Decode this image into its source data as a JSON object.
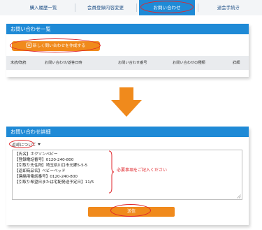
{
  "nav": {
    "tabs": [
      {
        "label": "購入履歴一覧"
      },
      {
        "label": "会員登録内容変更"
      },
      {
        "label": "お問い合わせ"
      },
      {
        "label": "退会手続き"
      }
    ],
    "active_index": 2
  },
  "list_panel": {
    "title": "お問い合わせ一覧",
    "create_button_label": "新しく問い合わせを作成する",
    "columns": [
      "未読/既読",
      "お問い合わせ/返答日時",
      "お問い合わせ番号",
      "お問い合わせの種類",
      "詳細"
    ]
  },
  "detail_panel": {
    "title": "お問い合わせ詳細",
    "category_selected": "返却について",
    "message_lines": [
      "【氏名】ホクソンベビー",
      "【登録電話番号】0120-240-800",
      "【引取り先住所】埼玉県川口市元郷5-5-5",
      "【返却商品名】ベビーベッド",
      "【連絡用電話番号】0120-240-800",
      "【引取り希望日または宅配発送予定日】11/5"
    ],
    "annotation": "必要事項をご記入ください",
    "submit_label": "送信"
  },
  "colors": {
    "accent_blue": "#1f8ad6",
    "action_orange": "#f08a1c",
    "highlight_red": "#e0262b"
  }
}
